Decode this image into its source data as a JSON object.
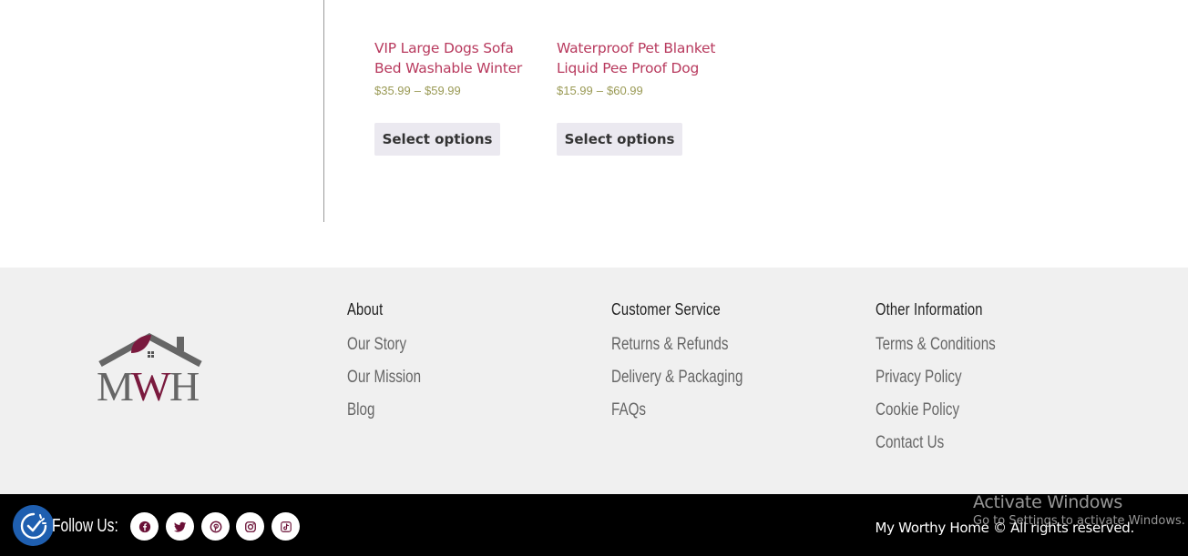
{
  "products": [
    {
      "title": "VIP Large Dogs Sofa Bed Washable Winter",
      "price_min": "$35.99",
      "price_sep": "–",
      "price_max": "$59.99",
      "button_label": "Select options"
    },
    {
      "title": "Waterproof Pet Blanket Liquid Pee Proof Dog",
      "price_min": "$15.99",
      "price_sep": "–",
      "price_max": "$60.99",
      "button_label": "Select options"
    }
  ],
  "footer": {
    "logo_text": "MWH",
    "columns": [
      {
        "heading": "About",
        "links": [
          "Our Story",
          "Our Mission",
          "Blog"
        ]
      },
      {
        "heading": "Customer Service",
        "links": [
          "Returns & Refunds",
          "Delivery & Packaging",
          "FAQs"
        ]
      },
      {
        "heading": "Other Information",
        "links": [
          "Terms & Conditions",
          "Privacy Policy",
          "Cookie Policy",
          "Contact Us"
        ]
      }
    ]
  },
  "bottom_bar": {
    "follow_label": "Follow Us:",
    "social_icons": [
      "facebook-icon",
      "twitter-icon",
      "pinterest-icon",
      "instagram-icon",
      "tiktok-icon"
    ],
    "copyright": "My Worthy Home © All rights reserved."
  },
  "watermark": {
    "line1": "Activate Windows",
    "line2": "Go to Settings to activate Windows."
  },
  "colors": {
    "product_title": "#b83a5e",
    "price": "#9a9a55",
    "button_bg": "#ebe9f0",
    "footer_bg": "#f0f0f0",
    "bottom_bg": "#000000",
    "social_icon": "#6a1036",
    "logo_accent": "#7a1a3e",
    "logo_gray": "#666666"
  }
}
